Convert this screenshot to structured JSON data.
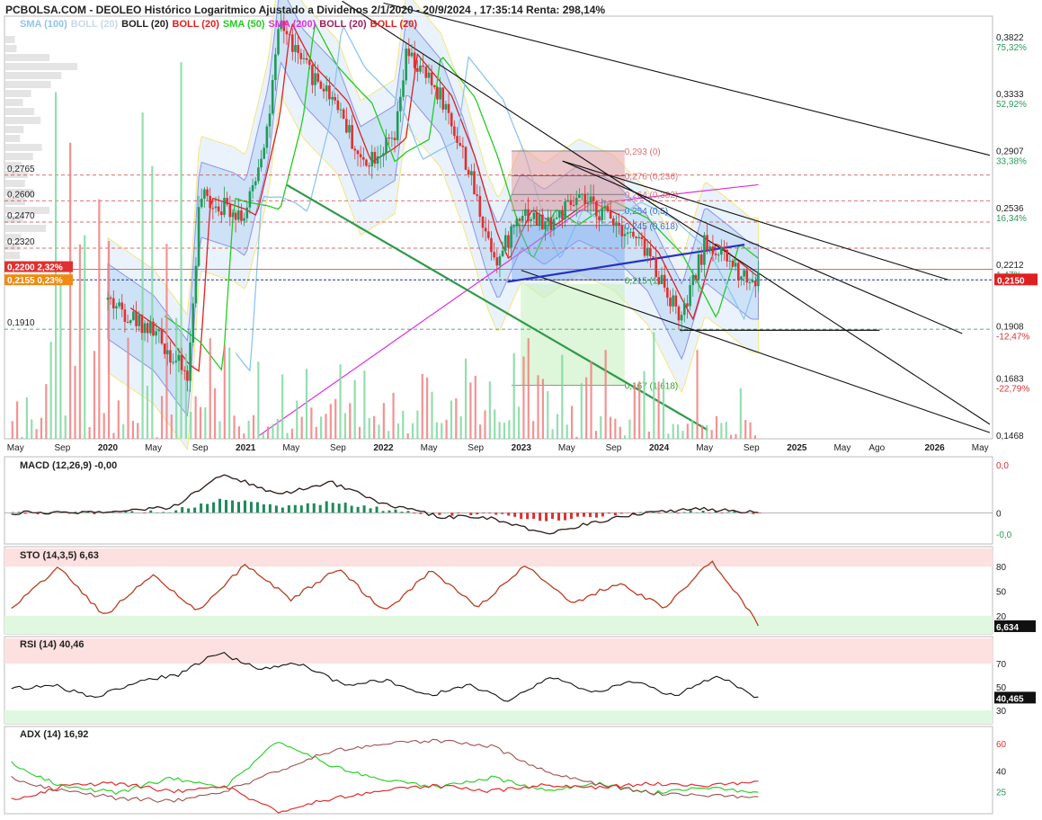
{
  "header": {
    "title": "PCBOLSA.COM - DEOLEO Histórico Logaritmico Ajustado a Dividenos 2/1/2020 - 20/9/2024 , 17:35:14 Renta: 298,14%"
  },
  "legend": [
    {
      "label": "SMA (100)",
      "color": "#8ec5f0"
    },
    {
      "label": "BOLL (20)",
      "color": "#c8d8ee"
    },
    {
      "label": "BOLL (20)",
      "color": "#222222"
    },
    {
      "label": "BOLL (20)",
      "color": "#e02020"
    },
    {
      "label": "SMA (50)",
      "color": "#22cc22"
    },
    {
      "label": "SMA (200)",
      "color": "#e030e0"
    },
    {
      "label": "BOLL (20)",
      "color": "#a02060"
    },
    {
      "label": "BOLL (20)",
      "color": "#e02020"
    }
  ],
  "panels": {
    "macd": {
      "title": "MACD (12,26,9)   -0,00"
    },
    "sto": {
      "title": "STO (14,3,5)   6,63"
    },
    "rsi": {
      "title": "RSI (14)   40,46"
    },
    "adx": {
      "title": "ADX (14)   16,92"
    }
  },
  "chart_data": [
    {
      "type": "candlestick",
      "scale": "log",
      "x_ticks": [
        "May",
        "Sep",
        "2020",
        "May",
        "Sep",
        "2021",
        "May",
        "Sep",
        "2022",
        "May",
        "Sep",
        "2023",
        "May",
        "Sep",
        "2024",
        "May",
        "Sep",
        "2025",
        "May",
        "Ago",
        "2026",
        "May"
      ],
      "y_ticks_right": [
        {
          "price": "0,3822",
          "pct": "75,32%"
        },
        {
          "price": "0,3333",
          "pct": "52,92%"
        },
        {
          "price": "0,2907",
          "pct": "33,38%"
        },
        {
          "price": "0,2536",
          "pct": "16,34%"
        },
        {
          "price": "0,2212",
          "pct": "1,47%"
        },
        {
          "price": "0,1908",
          "pct": "-12,47%"
        },
        {
          "price": "0,1683",
          "pct": "-22,79%"
        },
        {
          "price": "0,1468",
          "pct": ""
        }
      ],
      "last_price": "0,2150",
      "horizontal_levels_left": [
        "0,2765",
        "0,2600",
        "0,2470",
        "0,2320",
        "0,1910"
      ],
      "left_tags": [
        "0,2200  2,32%",
        "0,2155  0,23%"
      ],
      "fibonacci": [
        "0,293 (0)",
        "0,276 (0,236)",
        "0,264 (0,382)",
        "0,254 (0,5)",
        "0,245 (0,618)",
        "0,215 (1)",
        "0,167 (1,618)"
      ],
      "close_path": [
        [
          "2020-01",
          0.205
        ],
        [
          "2020-05",
          0.19
        ],
        [
          "2020-08",
          0.17
        ],
        [
          "2020-09",
          0.262
        ],
        [
          "2020-12",
          0.255
        ],
        [
          "2021-01",
          0.25
        ],
        [
          "2021-03",
          0.315
        ],
        [
          "2021-04",
          0.4
        ],
        [
          "2021-06",
          0.36
        ],
        [
          "2021-09",
          0.33
        ],
        [
          "2021-11",
          0.285
        ],
        [
          "2022-02",
          0.3
        ],
        [
          "2022-03",
          0.37
        ],
        [
          "2022-06",
          0.335
        ],
        [
          "2022-08",
          0.29
        ],
        [
          "2022-10",
          0.24
        ],
        [
          "2022-11",
          0.225
        ],
        [
          "2023-01",
          0.255
        ],
        [
          "2023-03",
          0.245
        ],
        [
          "2023-06",
          0.26
        ],
        [
          "2023-09",
          0.25
        ],
        [
          "2023-12",
          0.23
        ],
        [
          "2024-03",
          0.195
        ],
        [
          "2024-05",
          0.235
        ],
        [
          "2024-07",
          0.225
        ],
        [
          "2024-09",
          0.215
        ]
      ]
    },
    {
      "type": "line",
      "name": "MACD (12,26,9)",
      "y_ticks": [
        "0,0",
        "0",
        "-0,0"
      ],
      "values": [
        0,
        0,
        0.001,
        0.003,
        0.022,
        0.01,
        0.017,
        0.005,
        -0.002,
        -0.003,
        -0.012,
        -0.005,
        0.001,
        0.002,
        0
      ]
    },
    {
      "type": "line",
      "name": "STO (14,3,5)",
      "y_ticks": [
        "80",
        "50",
        "20"
      ],
      "last": "6,634",
      "values": [
        28,
        80,
        20,
        70,
        25,
        82,
        40,
        78,
        25,
        75,
        30,
        82,
        35,
        60,
        30,
        88,
        10
      ]
    },
    {
      "type": "line",
      "name": "RSI (14)",
      "y_ticks": [
        "70",
        "50",
        "30"
      ],
      "last": "40,465",
      "values": [
        48,
        52,
        40,
        55,
        60,
        80,
        65,
        70,
        52,
        56,
        42,
        52,
        38,
        58,
        45,
        55,
        42,
        60,
        40
      ]
    },
    {
      "type": "line",
      "name": "ADX (14)",
      "y_ticks": [
        "60",
        "40",
        "25"
      ],
      "values": [
        42,
        22,
        18,
        30,
        22,
        60,
        40,
        28,
        22,
        30,
        20,
        25,
        18,
        22,
        17
      ]
    }
  ]
}
